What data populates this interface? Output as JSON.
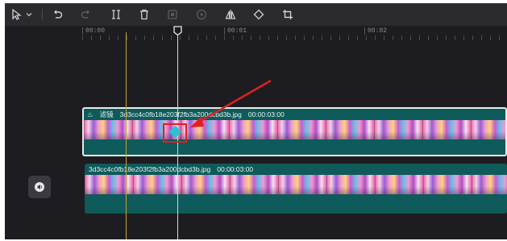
{
  "toolbar": {
    "tools": [
      {
        "name": "select-pointer-icon",
        "enabled": true
      },
      {
        "name": "chevron-down-icon",
        "enabled": true
      },
      {
        "name": "undo-icon",
        "enabled": true
      },
      {
        "name": "redo-icon",
        "enabled": false
      },
      {
        "name": "split-icon",
        "enabled": true
      },
      {
        "name": "delete-icon",
        "enabled": true
      },
      {
        "name": "freeze-icon",
        "enabled": false
      },
      {
        "name": "play-reverse-icon",
        "enabled": false
      },
      {
        "name": "mirror-icon",
        "enabled": true
      },
      {
        "name": "rotate-icon",
        "enabled": true
      },
      {
        "name": "crop-icon",
        "enabled": true
      }
    ]
  },
  "ruler": {
    "labels": [
      "00:00",
      "00:01",
      "00:02"
    ]
  },
  "tracks": [
    {
      "filter_label": "滤镜",
      "filename": "3d3cc4c0fb18e203f2fb3a200dcbd3b.jpg",
      "duration": "00:00:03:00",
      "selected": true
    },
    {
      "filename": "3d3cc4c0fb18e203f2fb3a200dcbd3b.jpg",
      "duration": "00:00:03:00",
      "selected": false
    }
  ],
  "colors": {
    "track": "#0f5a5a",
    "playhead": "#d8d8d8",
    "marker": "#c9a227",
    "keyframe": "#27c3d3",
    "annotation": "#e02020"
  }
}
